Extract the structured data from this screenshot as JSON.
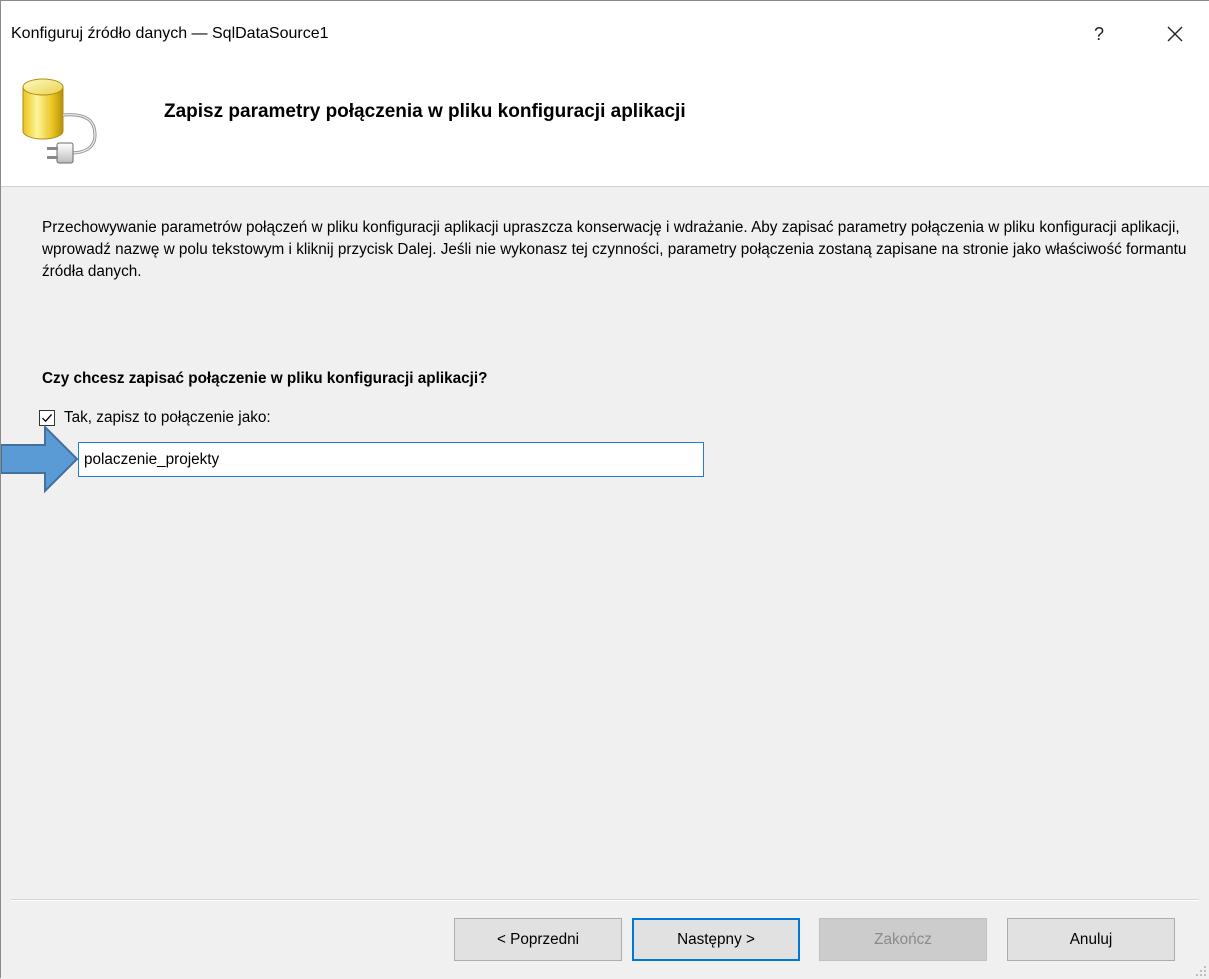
{
  "window": {
    "title": "Konfiguruj źródło danych — SqlDataSource1",
    "help_label": "?"
  },
  "header": {
    "title": "Zapisz parametry połączenia w pliku konfiguracji aplikacji",
    "icon": "database-plug-icon"
  },
  "content": {
    "description": "Przechowywanie parametrów połączeń w pliku konfiguracji aplikacji upraszcza konserwację i wdrażanie. Aby zapisać parametry połączenia w pliku konfiguracji aplikacji, wprowadź nazwę w polu tekstowym i kliknij przycisk Dalej. Jeśli nie wykonasz tej czynności, parametry połączenia zostaną zapisane na stronie jako właściwość formantu źródła danych.",
    "question": "Czy chcesz zapisać połączenie w pliku konfiguracji aplikacji?",
    "save_checkbox": {
      "label": "Tak, zapisz to połączenie jako:",
      "checked": true
    },
    "connection_name": "polaczenie_projekty",
    "arrow_color": "#5b9bd5"
  },
  "footer": {
    "prev_label": "< Poprzedni",
    "next_label": "Następny >",
    "finish_label": "Zakończ",
    "cancel_label": "Anuluj"
  }
}
